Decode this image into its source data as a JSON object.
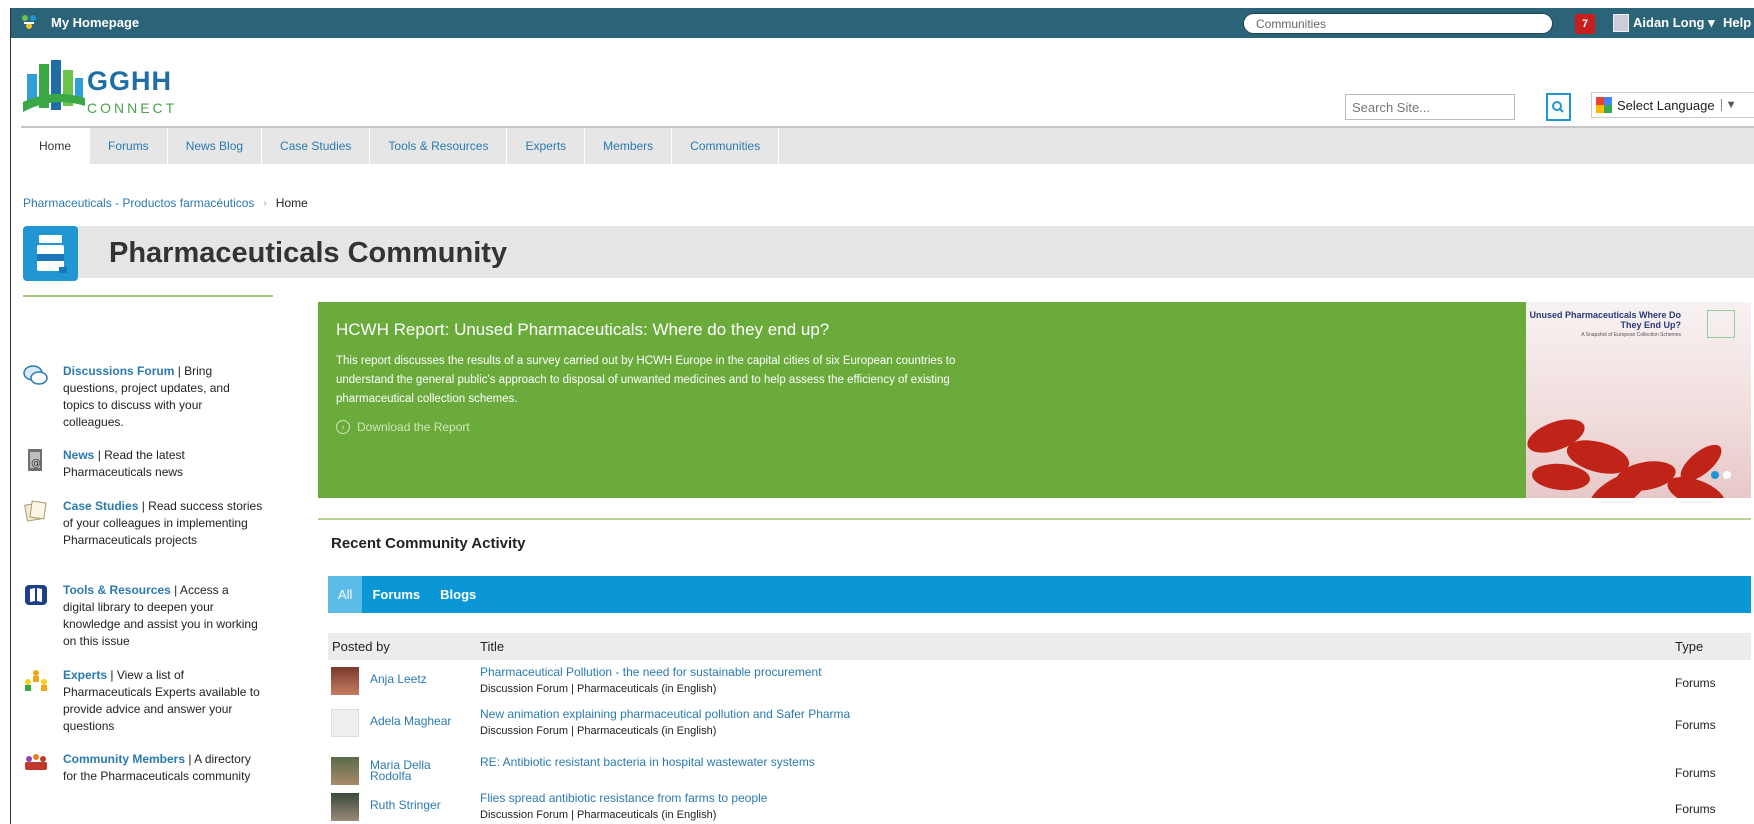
{
  "topbar": {
    "home_label": "My Homepage",
    "communities_search": "Communities",
    "notification_count": "7",
    "user_name": "Aidan Long ▾",
    "help": "Help"
  },
  "logo": {
    "brand": "GGHH",
    "sub": "CONNECT"
  },
  "site_search_placeholder": "Search Site...",
  "language": "Select Language",
  "nav": [
    "Home",
    "Forums",
    "News Blog",
    "Case Studies",
    "Tools & Resources",
    "Experts",
    "Members",
    "Communities"
  ],
  "breadcrumb": {
    "parent": "Pharmaceuticals - Productos farmacéuticos",
    "separator": "›",
    "current": "Home"
  },
  "page_title": "Pharmaceuticals Community",
  "sidebar": [
    {
      "link": "Discussions Forum",
      "text": " | Bring questions, project updates,  and topics to discuss with your colleagues.",
      "icon": "chat-bubbles-icon"
    },
    {
      "link": "News",
      "text": " | Read the latest Pharmaceuticals news",
      "icon": "news-icon"
    },
    {
      "link": "Case Studies",
      "text": " | Read success stories of your colleagues in implementing Pharmaceuticals projects",
      "icon": "documents-icon"
    },
    {
      "link": "Tools & Resources",
      "text": " | Access a digital library to deepen your knowledge and assist you in working on this issue",
      "icon": "book-icon"
    },
    {
      "link": "Experts",
      "text": " | View a list of Pharmaceuticals Experts available to provide advice and answer your questions",
      "icon": "experts-icon"
    },
    {
      "link": "Community Members",
      "text": " | A directory for the Pharmaceuticals community",
      "icon": "members-icon"
    }
  ],
  "banner": {
    "title": "HCWH Report: Unused Pharmaceuticals: Where do they end up?",
    "body": "This report discusses the results of a survey carried out by HCWH Europe in the capital cities of six European countries to understand the general public's approach to disposal of unwanted medicines and to help assess the efficiency of existing pharmaceutical collection schemes.",
    "download": "Download the Report",
    "cover_title": "Unused Pharmaceuticals Where Do They End Up?",
    "cover_sub": "A Snapshot of European Collection Schemes",
    "slide_index": 1,
    "slide_count": 2
  },
  "activity": {
    "heading": "Recent Community Activity",
    "filters": [
      "All",
      "Forums",
      "Blogs"
    ],
    "columns": {
      "posted_by": "Posted by",
      "title": "Title",
      "type": "Type"
    },
    "rows": [
      {
        "name": "Anja Leetz",
        "title": "Pharmaceutical Pollution - the need for sustainable procurement",
        "sub": "Discussion Forum | Pharmaceuticals (in English)",
        "type": "Forums"
      },
      {
        "name": "Adela Maghear",
        "title": "New animation explaining pharmaceutical pollution and Safer Pharma",
        "sub": "Discussion Forum | Pharmaceuticals (in English)",
        "type": "Forums"
      },
      {
        "name": "Maria Della Rodolfa",
        "title": "RE: Antibiotic resistant bacteria in hospital wastewater systems",
        "sub": "",
        "type": "Forums"
      },
      {
        "name": "Ruth Stringer",
        "title": "Flies spread antibiotic resistance from farms to people",
        "sub": "Discussion Forum | Pharmaceuticals (in English)",
        "type": "Forums"
      }
    ]
  },
  "colors": {
    "topbar": "#2b6378",
    "accent": "#2196d3",
    "banner": "#6aab3c",
    "link": "#2a7ab0",
    "badge": "#c81e1e"
  }
}
